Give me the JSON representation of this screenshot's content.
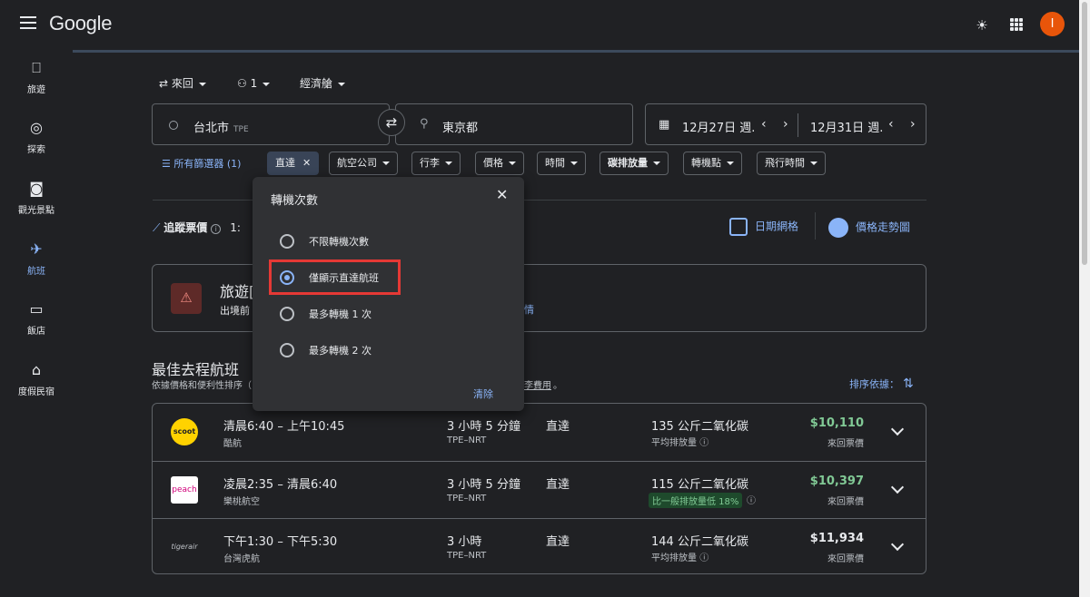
{
  "header": {
    "logo": "Google",
    "avatar_letter": "I"
  },
  "sidebar": {
    "items": [
      {
        "label": "旅遊",
        "icon": "luggage-icon"
      },
      {
        "label": "探索",
        "icon": "explore-icon"
      },
      {
        "label": "觀光景點",
        "icon": "camera-icon"
      },
      {
        "label": "航班",
        "icon": "flight-icon",
        "active": true
      },
      {
        "label": "飯店",
        "icon": "hotel-icon"
      },
      {
        "label": "度假民宿",
        "icon": "home-icon"
      }
    ]
  },
  "search": {
    "trip_type": "來回",
    "passengers": "1",
    "cabin": "經濟艙",
    "origin": "台北市",
    "origin_code": "TPE",
    "destination": "東京都",
    "depart_date": "12月27日 週.",
    "return_date": "12月31日 週."
  },
  "filters": {
    "all_label": "所有篩選器 (1)",
    "chips": [
      "直達",
      "航空公司",
      "行李",
      "價格",
      "時間",
      "碳排放量",
      "轉機點",
      "飛行時間"
    ]
  },
  "tracking": {
    "label": "追蹤票價",
    "dates_partial": "1:",
    "date_grid": "日期網格",
    "price_graph": "價格走勢圖"
  },
  "notice": {
    "title": "旅遊[",
    "text": "出境前",
    "link": "情"
  },
  "best": {
    "title": "最佳去程航班",
    "subtitle": "依據價格和便利性排序（",
    "fee_link": "李費用",
    "fee_suffix": "。",
    "sort_label": "排序依據："
  },
  "flights": [
    {
      "time": "清晨6:40 – 上午10:45",
      "airline": "酷航",
      "duration": "3 小時 5 分鐘",
      "route": "TPE–NRT",
      "stops": "直達",
      "co2": "135 公斤二氧化碳",
      "co2_note": "平均排放量",
      "price": "$10,110",
      "price_type": "來回票價",
      "logo": "scoot",
      "logo_color": "#ffd200"
    },
    {
      "time": "凌晨2:35 – 清晨6:40",
      "airline": "樂桃航空",
      "duration": "3 小時 5 分鐘",
      "route": "TPE–NRT",
      "stops": "直達",
      "co2": "115 公斤二氧化碳",
      "co2_note": "比一般排放量低 18%",
      "price": "$10,397",
      "price_type": "來回票價",
      "logo": "peach",
      "logo_color": "#ffffff"
    },
    {
      "time": "下午1:30 – 下午5:30",
      "airline": "台灣虎航",
      "duration": "3 小時",
      "route": "TPE–NRT",
      "stops": "直達",
      "co2": "144 公斤二氧化碳",
      "co2_note": "平均排放量",
      "price": "$11,934",
      "price_type": "來回票價",
      "logo": "tigerair",
      "logo_color": "#202124"
    }
  ],
  "stops_popup": {
    "title": "轉機次數",
    "options": [
      "不限轉機次數",
      "僅顯示直達航班",
      "最多轉機 1 次",
      "最多轉機 2 次"
    ],
    "selected": "僅顯示直達航班",
    "clear": "清除"
  }
}
